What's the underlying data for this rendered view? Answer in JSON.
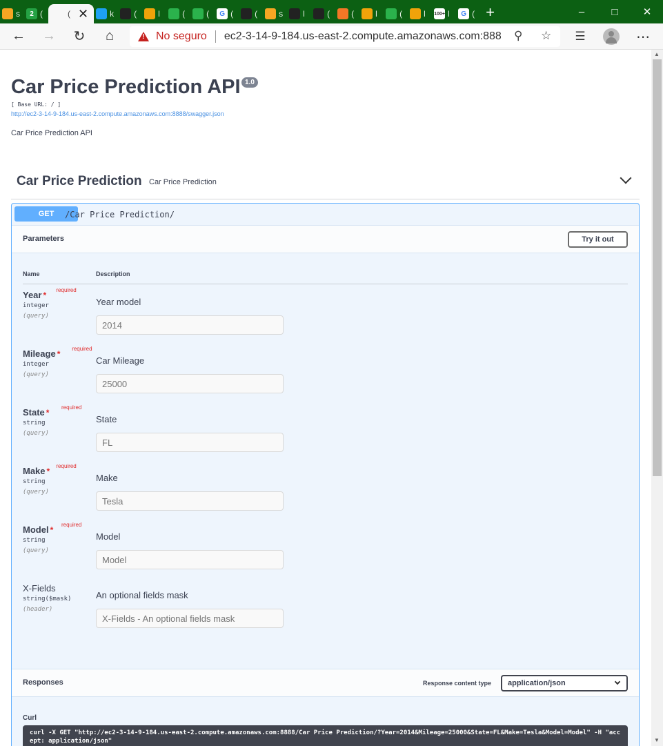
{
  "browser": {
    "tabs": [
      {
        "title": "s",
        "icon": "bar-chart-icon",
        "color": "#f6a623"
      },
      {
        "title": "(",
        "icon": "whatsapp-badge-icon",
        "color": "#25a244",
        "badge": "2"
      },
      {
        "title": "(",
        "icon": "close-icon",
        "color": "#333333",
        "active": true
      },
      {
        "title": "k",
        "icon": "k-letter-icon",
        "color": "#1da1f2"
      },
      {
        "title": "(",
        "icon": "github-icon",
        "color": "#222222"
      },
      {
        "title": "l",
        "icon": "box-icon",
        "color": "#f0a30a"
      },
      {
        "title": "(",
        "icon": "globe-icon",
        "color": "#2bb24c"
      },
      {
        "title": "(",
        "icon": "globe-icon",
        "color": "#2bb24c"
      },
      {
        "title": "(",
        "icon": "google-icon",
        "color": "#ffffff"
      },
      {
        "title": "(",
        "icon": "github-icon",
        "color": "#222222"
      },
      {
        "title": "s",
        "icon": "bar-chart-icon",
        "color": "#f6a623"
      },
      {
        "title": "l",
        "icon": "github-icon",
        "color": "#222222"
      },
      {
        "title": "(",
        "icon": "github-icon",
        "color": "#222222"
      },
      {
        "title": "(",
        "icon": "jupyter-icon",
        "color": "#f37726"
      },
      {
        "title": "l",
        "icon": "book-icon",
        "color": "#f0a30a"
      },
      {
        "title": "(",
        "icon": "globe-icon",
        "color": "#2bb24c"
      },
      {
        "title": "l",
        "icon": "box-icon",
        "color": "#f0a30a"
      },
      {
        "title": "l",
        "icon": "gmail-icon",
        "color": "#ffffff",
        "badge": "100+"
      },
      {
        "title": "(",
        "icon": "google-icon",
        "color": "#ffffff"
      }
    ],
    "new_tab": "+",
    "security_text": "No seguro",
    "url": "ec2-3-14-9-184.us-east-2.compute.amazonaws.com:8888"
  },
  "api": {
    "title": "Car Price Prediction API",
    "version": "1.0",
    "base_url": "[ Base URL: / ]",
    "spec_link": "http://ec2-3-14-9-184.us-east-2.compute.amazonaws.com:8888/swagger.json",
    "description": "Car Price Prediction API"
  },
  "tag": {
    "name": "Car Price Prediction",
    "description": "Car Price Prediction"
  },
  "operation": {
    "method": "GET",
    "path": "/Car Price Prediction/",
    "parameters_label": "Parameters",
    "try_label": "Try it out",
    "col_name": "Name",
    "col_description": "Description",
    "required_label": "required",
    "params": [
      {
        "name": "Year",
        "required": true,
        "type": "integer",
        "in": "(query)",
        "description": "Year model",
        "placeholder": "2014"
      },
      {
        "name": "Mileage",
        "required": true,
        "type": "integer",
        "in": "(query)",
        "description": "Car Mileage",
        "placeholder": "25000"
      },
      {
        "name": "State",
        "required": true,
        "type": "string",
        "in": "(query)",
        "description": "State",
        "placeholder": "FL"
      },
      {
        "name": "Make",
        "required": true,
        "type": "string",
        "in": "(query)",
        "description": "Make",
        "placeholder": "Tesla"
      },
      {
        "name": "Model",
        "required": true,
        "type": "string",
        "in": "(query)",
        "description": "Model",
        "placeholder": "Model"
      },
      {
        "name": "X-Fields",
        "required": false,
        "type": "string($mask)",
        "in": "(header)",
        "description": "An optional fields mask",
        "placeholder": "X-Fields - An optional fields mask"
      }
    ],
    "responses_label": "Responses",
    "content_type_label": "Response content type",
    "content_type": "application/json",
    "curl_label": "Curl",
    "curl": "curl -X GET \"http://ec2-3-14-9-184.us-east-2.compute.amazonaws.com:8888/Car Price Prediction/?Year=2014&Mileage=25000&State=FL&Make=Tesla&Model=Model\" -H \"accept: application/json\""
  }
}
